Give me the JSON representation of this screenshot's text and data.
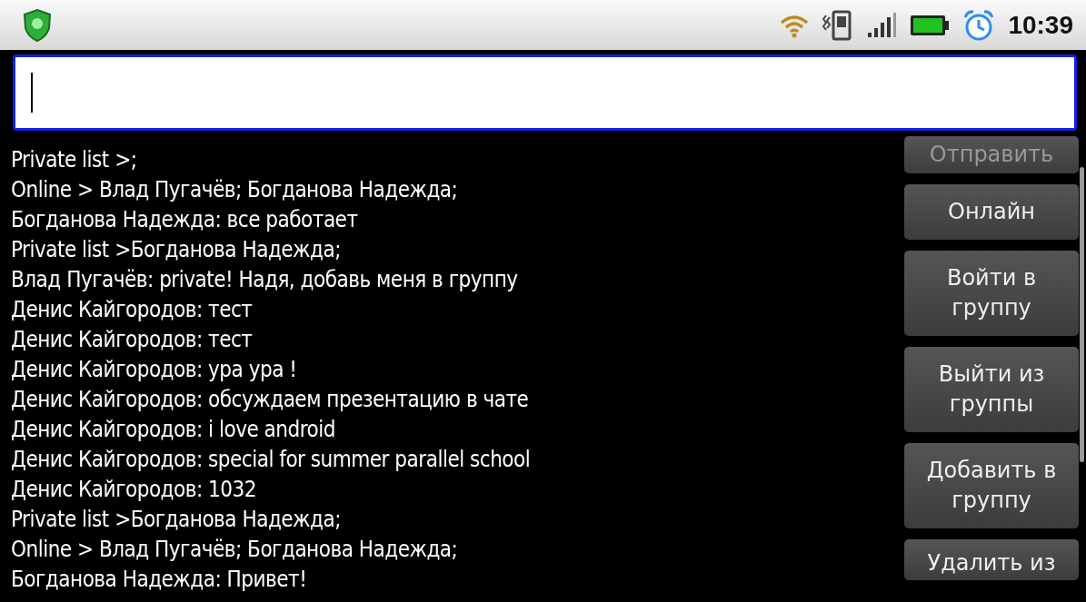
{
  "status_bar": {
    "time": "10:39"
  },
  "messages": [
    "Private list >;",
    "Online > Влад Пугачёв; Богданова Надежда;",
    "Богданова Надежда: все работает",
    "Private list >Богданова Надежда;",
    "Влад Пугачёв: private! Надя, добавь меня в группу",
    "Денис Кайгородов: тест",
    "Денис Кайгородов: тест",
    "Денис Кайгородов: ура ура !",
    "Денис Кайгородов: обсуждаем презентацию в чате",
    "Денис Кайгородов: i love android",
    "Денис Кайгородов: special for summer parallel school",
    "Денис Кайгородов: 1032",
    "Private list >Богданова Надежда;",
    "Online > Влад Пугачёв; Богданова Надежда;",
    "Богданова Надежда: Привет!"
  ],
  "buttons": [
    {
      "label": "Отправить",
      "kind": "top"
    },
    {
      "label": "Онлайн",
      "kind": "full"
    },
    {
      "label": "Войти в группу",
      "kind": "full"
    },
    {
      "label": "Выйти из группы",
      "kind": "full"
    },
    {
      "label": "Добавить в группу",
      "kind": "full"
    },
    {
      "label": "Удалить из",
      "kind": "bottom"
    }
  ]
}
